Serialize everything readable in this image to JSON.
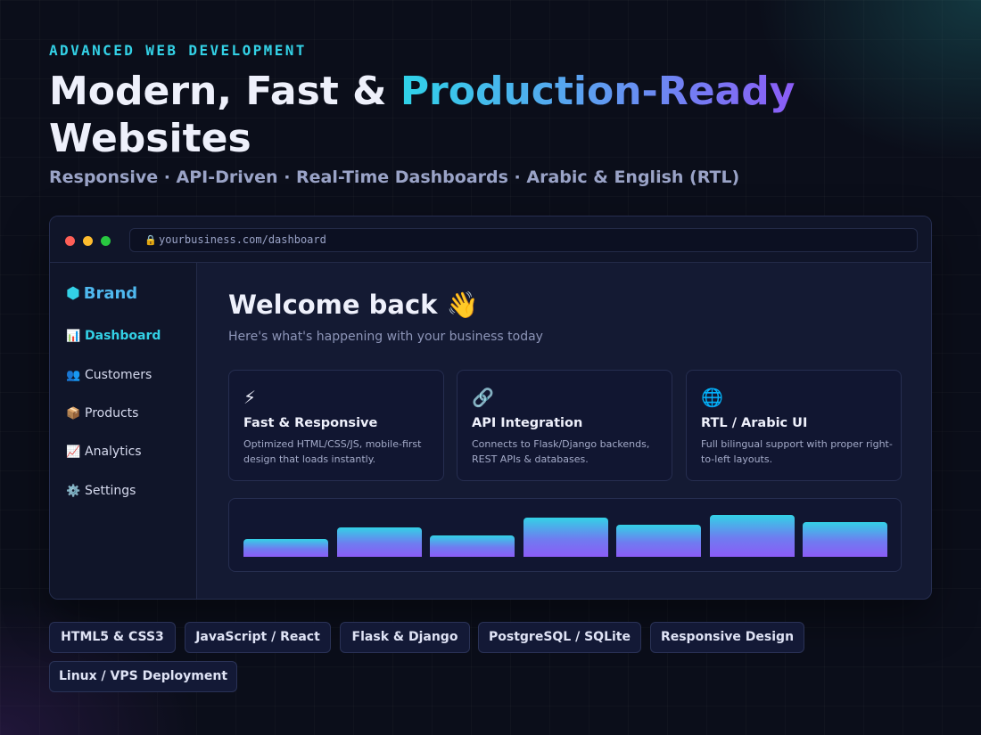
{
  "hero": {
    "eyebrow": "ADVANCED WEB DEVELOPMENT",
    "headline_part1": "Modern, Fast & ",
    "headline_highlight": "Production-Ready",
    "headline_part2": "Websites",
    "subtitle": "Responsive · API-Driven · Real-Time Dashboards · Arabic & English (RTL)"
  },
  "colors": {
    "accent_cyan": "#33d1e6",
    "accent_purple": "#8b5cf6",
    "background": "#0b0e1a",
    "panel": "#141a33"
  },
  "browser": {
    "lock_icon": "🔒",
    "url": "yourbusiness.com/dashboard"
  },
  "sidebar": {
    "brand_icon": "⬢",
    "brand": "Brand",
    "items": [
      {
        "icon": "📊",
        "icon_name": "bar-chart-icon",
        "label": "Dashboard",
        "active": true
      },
      {
        "icon": "👥",
        "icon_name": "users-icon",
        "label": "Customers",
        "active": false
      },
      {
        "icon": "📦",
        "icon_name": "package-icon",
        "label": "Products",
        "active": false
      },
      {
        "icon": "📈",
        "icon_name": "trend-up-icon",
        "label": "Analytics",
        "active": false
      },
      {
        "icon": "⚙️",
        "icon_name": "gear-icon",
        "label": "Settings",
        "active": false
      }
    ]
  },
  "main": {
    "welcome": "Welcome back 👋",
    "welcome_sub": "Here's what's happening with your business today",
    "cards": [
      {
        "icon": "⚡",
        "icon_name": "lightning-icon",
        "title": "Fast & Responsive",
        "desc": "Optimized HTML/CSS/JS, mobile-first design that loads instantly."
      },
      {
        "icon": "🔗",
        "icon_name": "link-icon",
        "title": "API Integration",
        "desc": "Connects to Flask/Django backends, REST APIs & databases."
      },
      {
        "icon": "🌐",
        "icon_name": "globe-icon",
        "title": "RTL / Arabic UI",
        "desc": "Full bilingual support with proper right-to-left layouts."
      }
    ]
  },
  "chart_data": {
    "type": "bar",
    "values": [
      0.43,
      0.7,
      0.52,
      0.93,
      0.77,
      1.0,
      0.84
    ],
    "ylim": [
      0,
      1
    ],
    "grid": false
  },
  "tech_tags": [
    "HTML5 & CSS3",
    "JavaScript / React",
    "Flask & Django",
    "PostgreSQL / SQLite",
    "Responsive Design",
    "Linux / VPS Deployment"
  ]
}
